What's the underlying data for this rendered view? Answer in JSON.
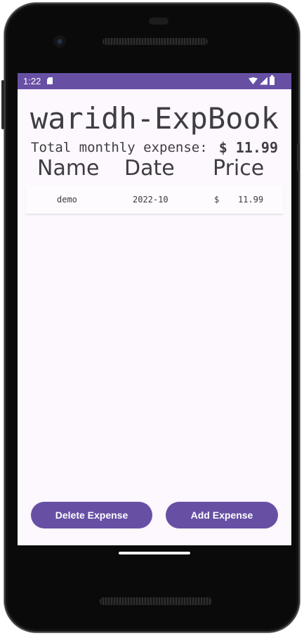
{
  "status_bar": {
    "time": "1:22",
    "icons": [
      "sd-card-icon",
      "wifi-icon",
      "signal-icon",
      "battery-icon"
    ]
  },
  "app": {
    "title": "waridh-ExpBook",
    "total_label": "Total monthly expense:",
    "total_value": "$ 11.99"
  },
  "table": {
    "columns": [
      "Name",
      "Date",
      "Price"
    ],
    "rows": [
      {
        "name": "demo",
        "date": "2022-10",
        "currency": "$",
        "amount": "11.99"
      }
    ]
  },
  "actions": {
    "delete_label": "Delete Expense",
    "add_label": "Add Expense"
  },
  "colors": {
    "accent": "#6750a4",
    "background": "#fdf7fe",
    "text": "#3f3d42"
  }
}
